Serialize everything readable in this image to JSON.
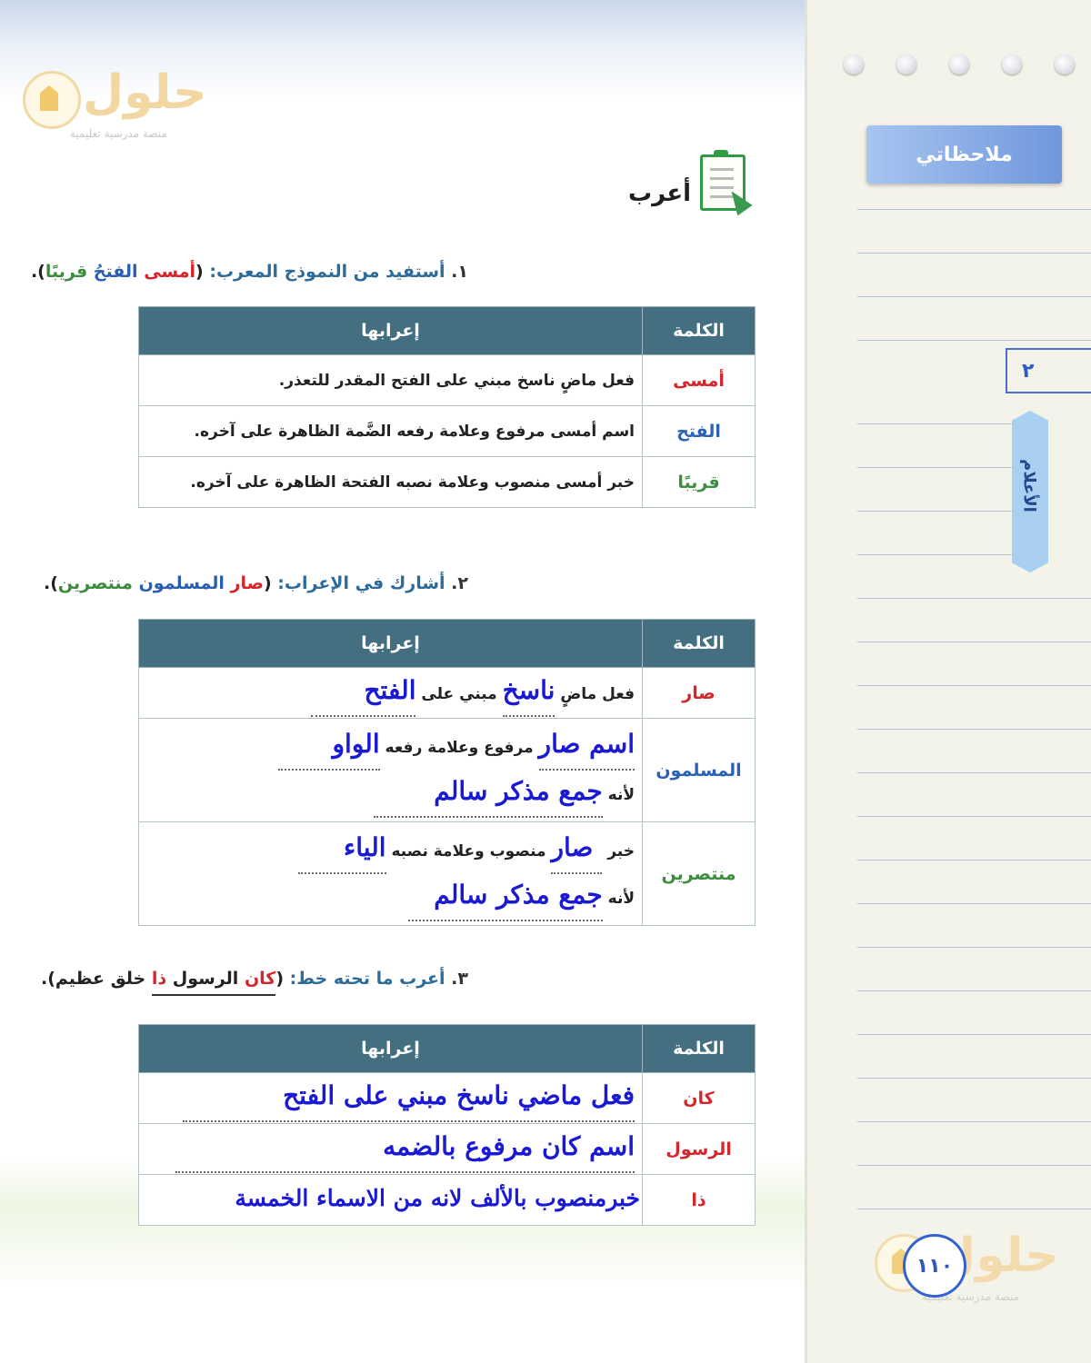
{
  "watermark": {
    "brand": "حلول",
    "tagline": "منصة مدرسية تعليمية"
  },
  "notes_panel": {
    "title": "ملاحظاتي",
    "unit_number": "٢",
    "unit_name": "الأعلام"
  },
  "page_number": "١١٠",
  "section_title": "أعرب",
  "q1": {
    "number": "١.",
    "prompt": "أستفيد من النموذج المعرب:",
    "example_open": "(",
    "example_w1": "أمسى",
    "example_w2": "الفتحُ",
    "example_w3": "قريبًا",
    "example_close": ").",
    "headers": {
      "word": "الكلمة",
      "parsing": "إعرابها"
    },
    "rows": [
      {
        "word": "أمسى",
        "parsing": "فعل ماضٍ ناسخ مبني على الفتح المقدر للتعذر."
      },
      {
        "word": "الفتح",
        "parsing": "اسم أمسى مرفوع وعلامة رفعه الضَّمة الظاهرة على آخره."
      },
      {
        "word": "قريبًا",
        "parsing": "خبر أمسى منصوب وعلامة نصبه الفتحة الظاهرة على آخره."
      }
    ]
  },
  "q2": {
    "number": "٢.",
    "prompt": "أشارك في الإعراب:",
    "example_open": "(",
    "example_w1": "صار",
    "example_w2": "المسلمون",
    "example_w3": "منتصرين",
    "example_close": ").",
    "headers": {
      "word": "الكلمة",
      "parsing": "إعرابها"
    },
    "rows": {
      "r1": {
        "word": "صار",
        "t1": "فعل ماضٍ",
        "h1": "ناسخ",
        "t2": "مبني على",
        "h2": "الفتح"
      },
      "r2": {
        "word": "المسلمون",
        "h1": "اسم صار",
        "t1": "مرفوع وعلامة رفعه",
        "h2": "الواو",
        "t2": "لأنه",
        "h3": "جمع مذكر سالم"
      },
      "r3": {
        "word": "منتصرين",
        "t1": "خبر",
        "h1": "صار",
        "t2": "منصوب وعلامة نصبه",
        "h2": "الياء",
        "t3": "لأنه",
        "h3": "جمع مذكر سالم"
      }
    }
  },
  "q3": {
    "number": "٣.",
    "prompt": "أعرب ما تحته خط:",
    "example_open": "(",
    "example_w1": "كان",
    "example_w2": "الرسول",
    "example_w3": "ذا",
    "example_rest": "خلق عظيم",
    "example_close": ").",
    "headers": {
      "word": "الكلمة",
      "parsing": "إعرابها"
    },
    "rows": [
      {
        "word": "كان",
        "answer": "فعل ماضي ناسخ مبني على الفتح"
      },
      {
        "word": "الرسول",
        "answer": "اسم كان مرفوع بالضمه"
      },
      {
        "word": "ذا",
        "answer": "خبرمنصوب بالألف لانه من الاسماء الخمسة"
      }
    ]
  }
}
